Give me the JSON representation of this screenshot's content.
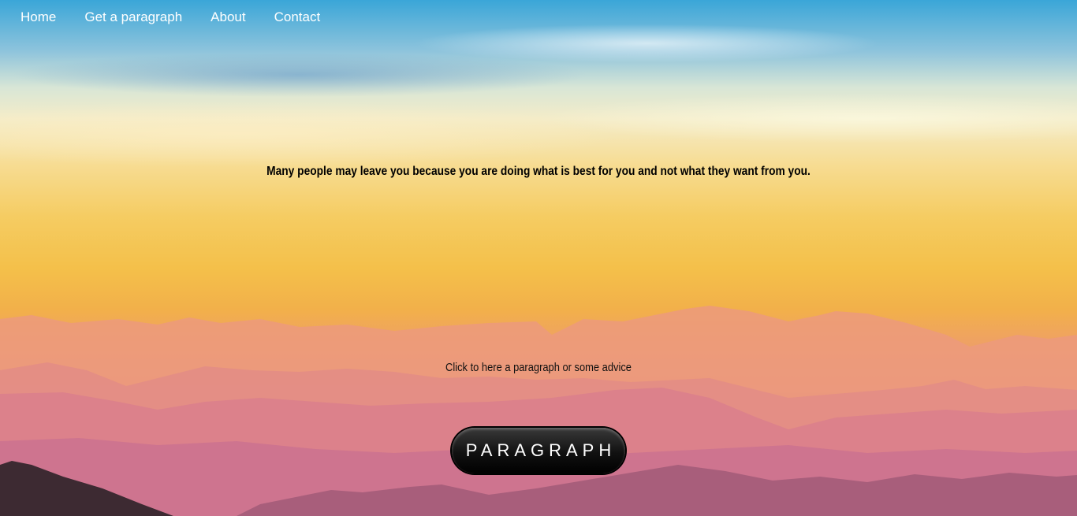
{
  "nav": {
    "items": [
      {
        "label": "Home"
      },
      {
        "label": "Get a paragraph"
      },
      {
        "label": "About"
      },
      {
        "label": "Contact"
      }
    ]
  },
  "main": {
    "quote": "Many people may leave you because you are doing what is best for you and not what they want from you.",
    "hint": "Click to here a paragraph or some advice",
    "button_label": "PARAGRAPH"
  },
  "colors": {
    "nav_text": "#ffffff",
    "button_bg": "#111111",
    "button_text": "#ffffff"
  }
}
